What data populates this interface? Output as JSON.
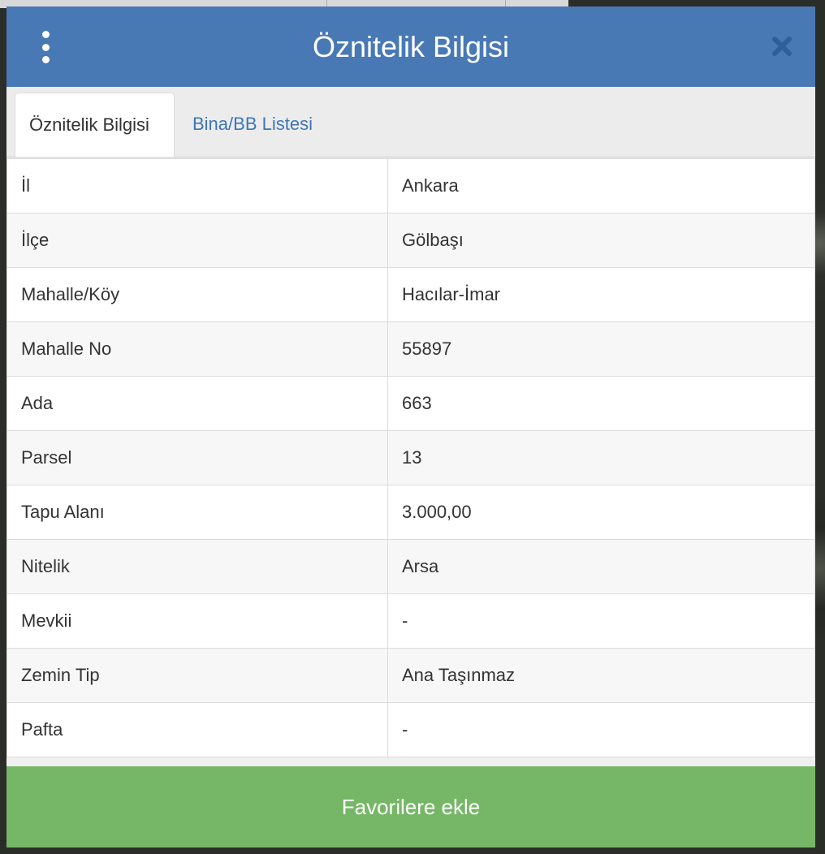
{
  "dialog": {
    "title": "Öznitelik Bilgisi",
    "menu_icon": "vertical-dots-icon",
    "close_icon": "close-icon",
    "header_color": "#4879b5"
  },
  "tabs": [
    {
      "label": "Öznitelik Bilgisi",
      "active": true
    },
    {
      "label": "Bina/BB Listesi",
      "active": false
    }
  ],
  "attributes": [
    {
      "key": "İl",
      "value": "Ankara"
    },
    {
      "key": "İlçe",
      "value": "Gölbaşı"
    },
    {
      "key": "Mahalle/Köy",
      "value": "Hacılar-İmar"
    },
    {
      "key": "Mahalle No",
      "value": "55897"
    },
    {
      "key": "Ada",
      "value": "663"
    },
    {
      "key": "Parsel",
      "value": "13"
    },
    {
      "key": "Tapu Alanı",
      "value": "3.000,00"
    },
    {
      "key": "Nitelik",
      "value": "Arsa"
    },
    {
      "key": "Mevkii",
      "value": "-"
    },
    {
      "key": "Zemin Tip",
      "value": "Ana Taşınmaz"
    },
    {
      "key": "Pafta",
      "value": "-"
    }
  ],
  "footer": {
    "favorite_label": "Favorilere ekle",
    "button_color": "#75b766"
  }
}
